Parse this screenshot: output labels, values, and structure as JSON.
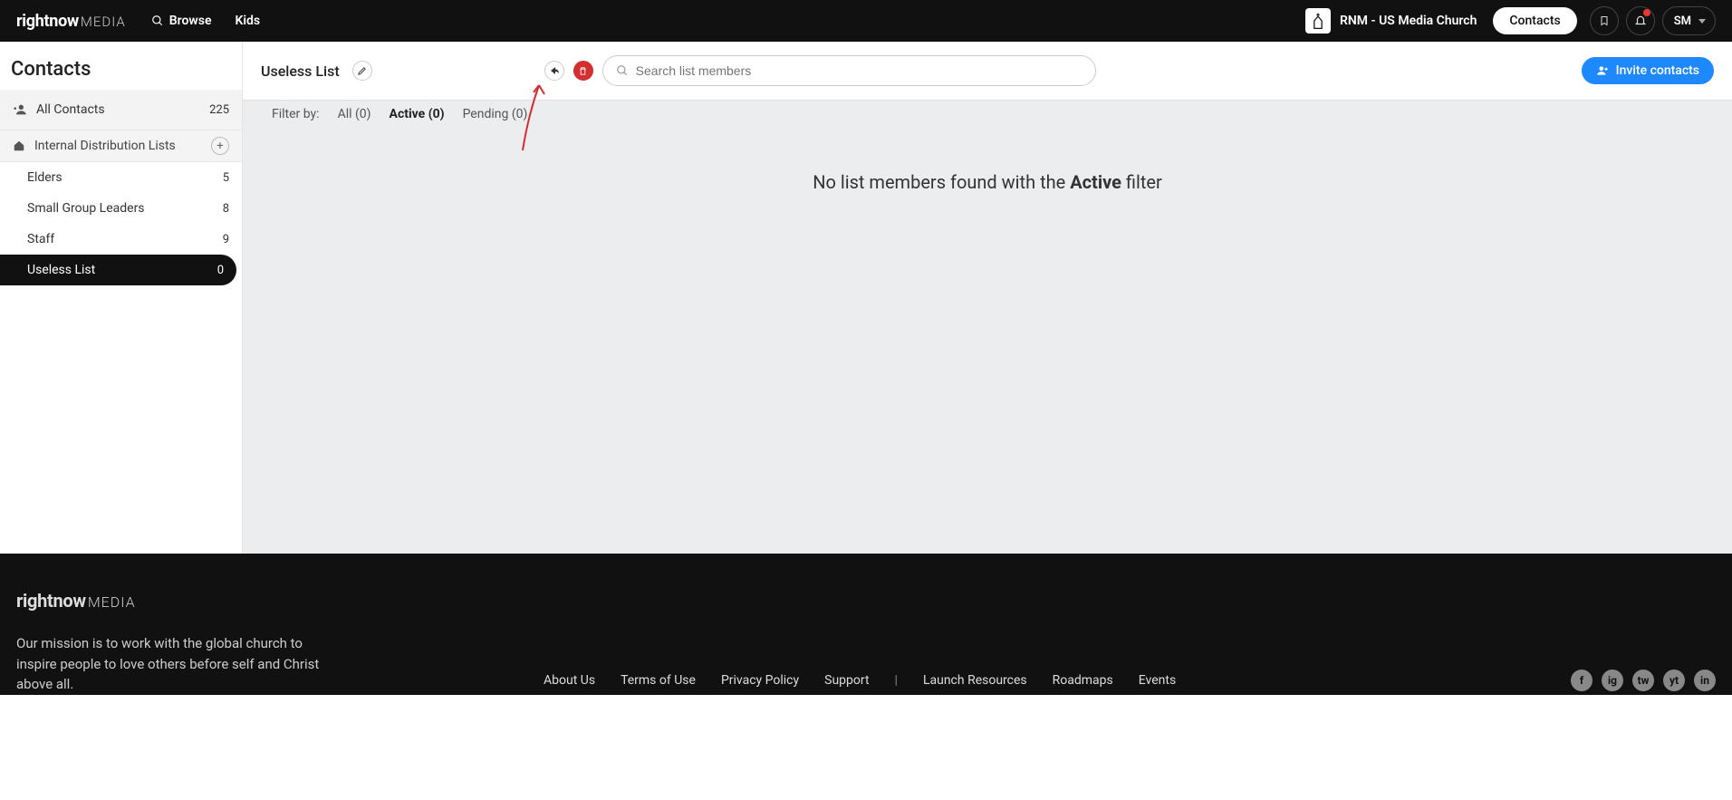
{
  "brand": {
    "bold": "rightnow",
    "light": "MEDIA"
  },
  "header": {
    "browse_label": "Browse",
    "kids_label": "Kids",
    "org_name": "RNM - US Media Church",
    "contacts_btn": "Contacts",
    "user_initials": "SM"
  },
  "sidebar": {
    "title": "Contacts",
    "all_contacts_label": "All Contacts",
    "all_contacts_count": "225",
    "section_label": "Internal Distribution Lists",
    "lists": [
      {
        "name": "Elders",
        "count": "5"
      },
      {
        "name": "Small Group Leaders",
        "count": "8"
      },
      {
        "name": "Staff",
        "count": "9"
      },
      {
        "name": "Useless List",
        "count": "0"
      }
    ]
  },
  "toolbar": {
    "list_title": "Useless List",
    "search_placeholder": "Search list members",
    "invite_label": "Invite contacts"
  },
  "filters": {
    "label": "Filter by:",
    "all": "All (0)",
    "active": "Active (0)",
    "pending": "Pending (0)"
  },
  "empty": {
    "prefix": "No list members found with the ",
    "strong": "Active",
    "suffix": " filter"
  },
  "footer": {
    "mission": "Our mission is to work with the global church to inspire people to love others before self and Christ above all.",
    "links": [
      "About Us",
      "Terms of Use",
      "Privacy Policy",
      "Support",
      "|",
      "Launch Resources",
      "Roadmaps",
      "Events"
    ],
    "social": [
      "f",
      "ig",
      "tw",
      "yt",
      "in"
    ]
  }
}
